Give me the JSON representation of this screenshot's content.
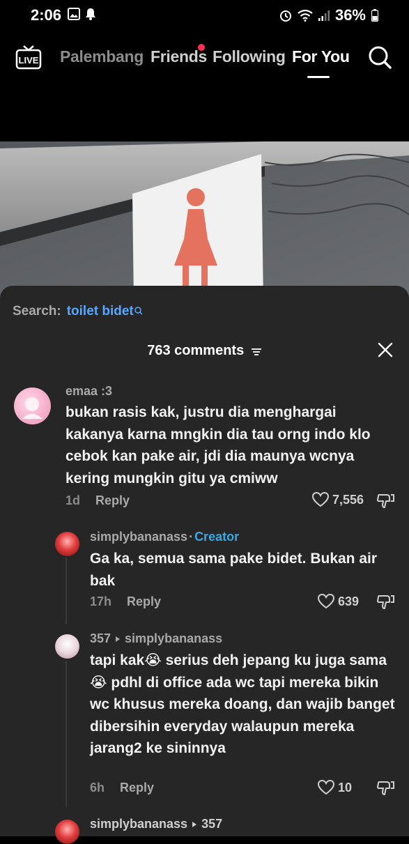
{
  "status_bar": {
    "time": "2:06",
    "battery": "36%"
  },
  "nav": {
    "tabs": [
      "Palembang",
      "Friends",
      "Following",
      "For You"
    ],
    "active": "For You"
  },
  "sheet": {
    "search_label": "Search:",
    "search_term": "toilet bidet",
    "comments_count": "763 comments"
  },
  "comments": [
    {
      "user": "emaa :3",
      "text": "bukan rasis kak, justru dia menghargai kakanya karna mngkin dia tau orng indo klo cebok kan pake air, jdi dia maunya wcnya kering mungkin gitu ya cmiww",
      "time": "1d",
      "reply_label": "Reply",
      "likes": "7,556"
    },
    {
      "user": "simplybananass",
      "separator": "·",
      "tag": "Creator",
      "text": "Ga ka, semua sama pake bidet. Bukan air bak",
      "time": "17h",
      "reply_label": "Reply",
      "likes": "639"
    },
    {
      "user": "357",
      "reply_to": "simplybananass",
      "text": "tapi kak😭 serius deh jepang ku juga sama 😭 pdhl di office ada wc tapi mereka bikin wc khusus mereka doang, dan wajib banget dibersihin everyday walaupun mereka jarang2 ke sininnya",
      "time": "6h",
      "reply_label": "Reply",
      "likes": "10"
    },
    {
      "user": "simplybananass",
      "reply_to": "357"
    }
  ],
  "colors": {
    "sheet_bg": "#262626",
    "link_blue": "#57a7ff",
    "creator_blue": "#3ea8e0",
    "notif_red": "#ff2d55"
  }
}
